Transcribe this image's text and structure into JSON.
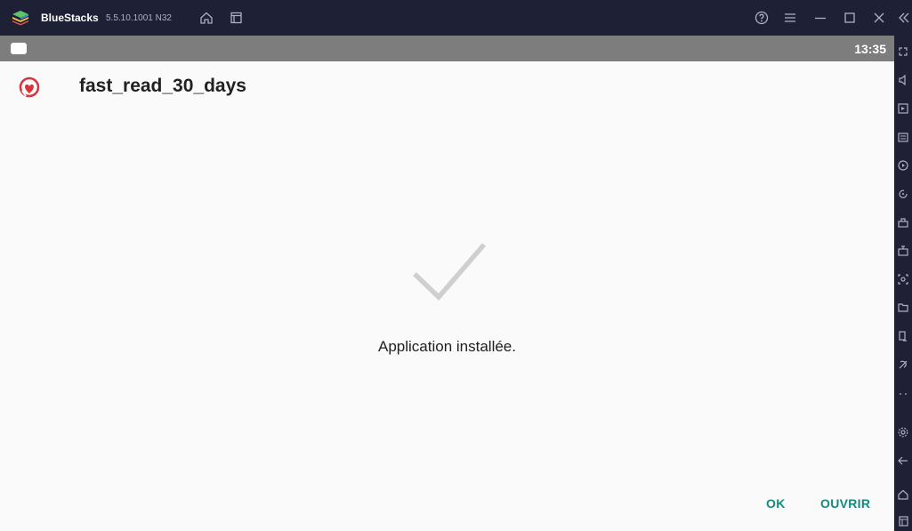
{
  "titlebar": {
    "app_name": "BlueStacks",
    "version": "5.5.10.1001 N32",
    "icons": [
      "bluestacks-logo-icon",
      "home-icon",
      "multi-instance-icon",
      "help-icon",
      "menu-icon",
      "minimize-icon",
      "maximize-icon",
      "close-icon",
      "collapse-sidebar-icon"
    ]
  },
  "statusbar": {
    "time": "13:35"
  },
  "app": {
    "title": "fast_read_30_days",
    "message": "Application installée.",
    "ok_label": "OK",
    "open_label": "OUVRIR"
  },
  "sidebar": {
    "icons": [
      "fullscreen-icon",
      "volume-icon",
      "media-manager-icon",
      "keyboard-controls-icon",
      "macro-icon",
      "rotate-icon",
      "screenshot-icon",
      "install-apk-icon",
      "camera-icon",
      "folder-icon",
      "multi-instance-sync-icon",
      "eco-mode-icon",
      "more-icon",
      "settings-icon",
      "back-icon",
      "home-icon",
      "recent-apps-icon"
    ]
  },
  "colors": {
    "accent": "#15897c",
    "titlebar_bg": "#1e2135",
    "statusbar_bg": "#7d7d7d",
    "app_bg": "#fafafa"
  }
}
